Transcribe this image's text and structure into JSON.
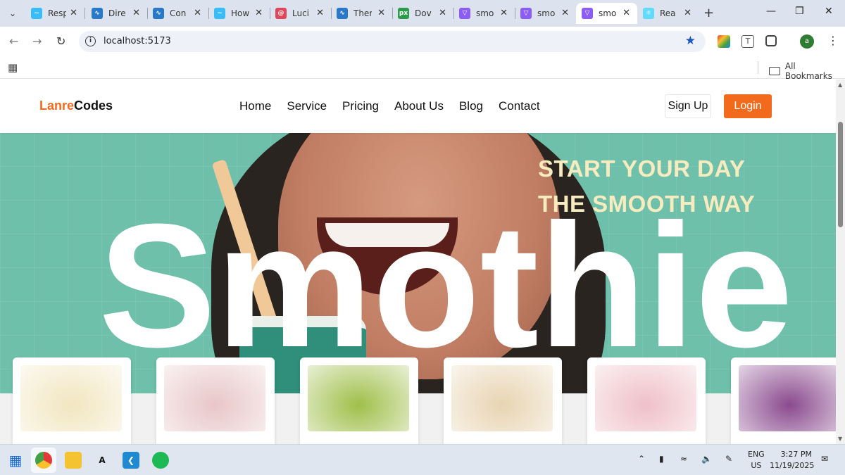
{
  "browser": {
    "tabs": [
      {
        "title": "Resp",
        "icon": "tailwind-icon",
        "color": "#38bdf8"
      },
      {
        "title": "Dire",
        "icon": "docs-icon",
        "color": "#2a79c8"
      },
      {
        "title": "Con",
        "icon": "docs-icon",
        "color": "#2a79c8"
      },
      {
        "title": "How",
        "icon": "tailwind-icon",
        "color": "#38bdf8"
      },
      {
        "title": "Luci",
        "icon": "lucide-icon",
        "color": "#e1455a"
      },
      {
        "title": "Ther",
        "icon": "docs-icon",
        "color": "#2a79c8"
      },
      {
        "title": "Dov",
        "icon": "px-icon",
        "color": "#2e9b4b"
      },
      {
        "title": "smo",
        "icon": "vite-icon",
        "color": "#8b5cf6"
      },
      {
        "title": "smo",
        "icon": "vite-icon",
        "color": "#8b5cf6"
      },
      {
        "title": "smo",
        "icon": "vite-icon",
        "color": "#8b5cf6"
      },
      {
        "title": "Rea",
        "icon": "react-icon",
        "color": "#61dafb"
      }
    ],
    "active_tab_index": 9,
    "url": "localhost:5173",
    "profile_initial": "a",
    "bookmarks_label": "All Bookmarks"
  },
  "site": {
    "logo_part1": "Lanre",
    "logo_part2": "Codes",
    "nav": [
      "Home",
      "Service",
      "Pricing",
      "About Us",
      "Blog",
      "Contact"
    ],
    "signup_label": "Sign Up",
    "login_label": "Login",
    "accent_color": "#f26b1d"
  },
  "hero": {
    "tagline_line1": "START YOUR DAY",
    "tagline_line2": "THE SMOOTH WAY",
    "big_word": "Smothie"
  },
  "cards": [
    {
      "image": "mango-lime-smoothie",
      "color": "#f2e6c0"
    },
    {
      "image": "assorted-smoothies-with-straws",
      "color": "#e8c6c8"
    },
    {
      "image": "green-kiwi-smoothie",
      "color": "#9fbf4a"
    },
    {
      "image": "banana-peanut-smoothie",
      "color": "#e8d4b2"
    },
    {
      "image": "strawberry-smoothie",
      "color": "#efc0c8"
    },
    {
      "image": "berry-smoothie",
      "color": "#8a4a8e"
    }
  ],
  "taskbar": {
    "lang_line1": "ENG",
    "lang_line2": "US",
    "time": "3:27 PM",
    "date": "11/19/2025"
  }
}
